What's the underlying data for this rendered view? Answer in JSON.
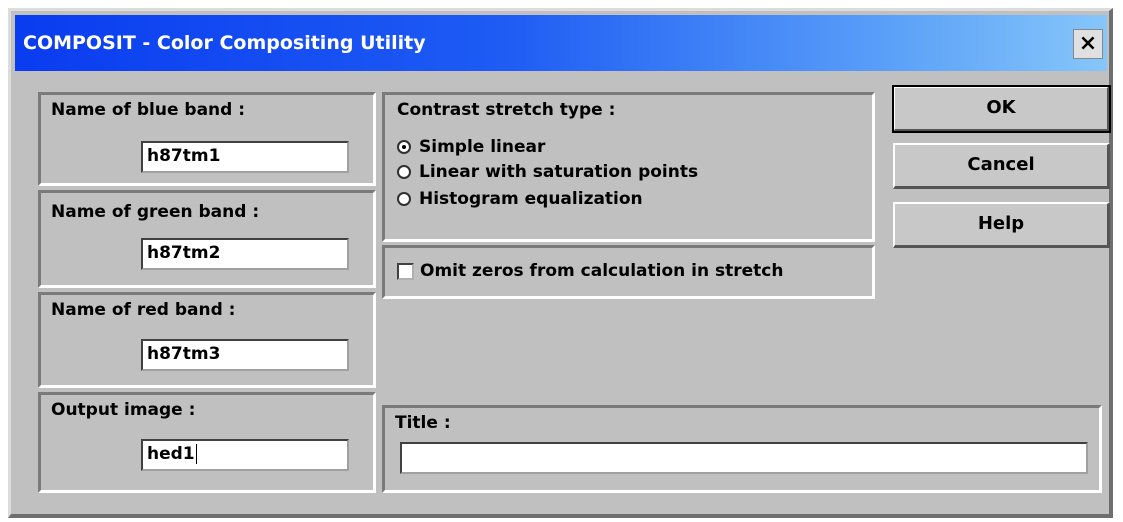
{
  "window": {
    "title": "COMPOSIT - Color Compositing Utility",
    "close_glyph": "×"
  },
  "bands": {
    "blue": {
      "label": "Name of blue band :",
      "value": "h87tm1"
    },
    "green": {
      "label": "Name of green band :",
      "value": "h87tm2"
    },
    "red": {
      "label": "Name of red band :",
      "value": "h87tm3"
    },
    "output": {
      "label": "Output image :",
      "value": "hed1"
    }
  },
  "stretch": {
    "label": "Contrast stretch type :",
    "options": [
      {
        "label": "Simple linear",
        "selected": true
      },
      {
        "label": "Linear with saturation points",
        "selected": false
      },
      {
        "label": "Histogram equalization",
        "selected": false
      }
    ]
  },
  "omit_zeros": {
    "label": "Omit zeros from calculation in stretch",
    "checked": false
  },
  "title_field": {
    "label": "Title :",
    "value": ""
  },
  "buttons": {
    "ok": "OK",
    "cancel": "Cancel",
    "help": "Help"
  },
  "colors": {
    "title_gradient_start": "#0a3cf0",
    "title_gradient_end": "#86c6fa",
    "dialog_face": "#c0c0c0"
  }
}
